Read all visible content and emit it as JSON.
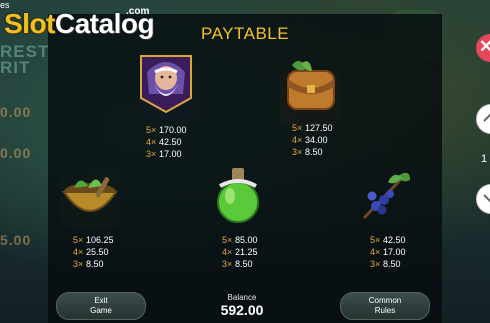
{
  "brand": {
    "slot": "Slot",
    "catalog": "Catalog",
    "tld": ".com"
  },
  "corner_text": "es",
  "background_text": {
    "line1": "REST",
    "line2": "RIT",
    "line3": "0.00",
    "line4": "0.00",
    "line5": "5.00"
  },
  "title": "PAYTABLE",
  "symbols": [
    {
      "name": "wizard",
      "icon": "wizard-icon",
      "pays": [
        {
          "mult": "5×",
          "value": "170.00"
        },
        {
          "mult": "4×",
          "value": "42.50"
        },
        {
          "mult": "3×",
          "value": "17.00"
        }
      ]
    },
    {
      "name": "satchel",
      "icon": "leather-satchel-icon",
      "pays": [
        {
          "mult": "5×",
          "value": "127.50"
        },
        {
          "mult": "4×",
          "value": "34.00"
        },
        {
          "mult": "3×",
          "value": "8.50"
        }
      ]
    },
    {
      "name": "herb bowl",
      "icon": "herb-bowl-icon",
      "pays": [
        {
          "mult": "5×",
          "value": "106.25"
        },
        {
          "mult": "4×",
          "value": "25.50"
        },
        {
          "mult": "3×",
          "value": "8.50"
        }
      ]
    },
    {
      "name": "potion",
      "icon": "green-potion-icon",
      "pays": [
        {
          "mult": "5×",
          "value": "85.00"
        },
        {
          "mult": "4×",
          "value": "21.25"
        },
        {
          "mult": "3×",
          "value": "8.50"
        }
      ]
    },
    {
      "name": "berries",
      "icon": "blueberry-branch-icon",
      "pays": [
        {
          "mult": "5×",
          "value": "42.50"
        },
        {
          "mult": "4×",
          "value": "17.00"
        },
        {
          "mult": "3×",
          "value": "8.50"
        }
      ]
    }
  ],
  "buttons": {
    "exit": {
      "line1": "Exit",
      "line2": "Game"
    },
    "rules": {
      "line1": "Common",
      "line2": "Rules"
    }
  },
  "balance": {
    "label": "Balance",
    "value": "592.00"
  },
  "page_indicator": "1",
  "colors": {
    "title": "#f2c22a",
    "multiplier": "#e3a93a",
    "close": "#e5485a"
  }
}
